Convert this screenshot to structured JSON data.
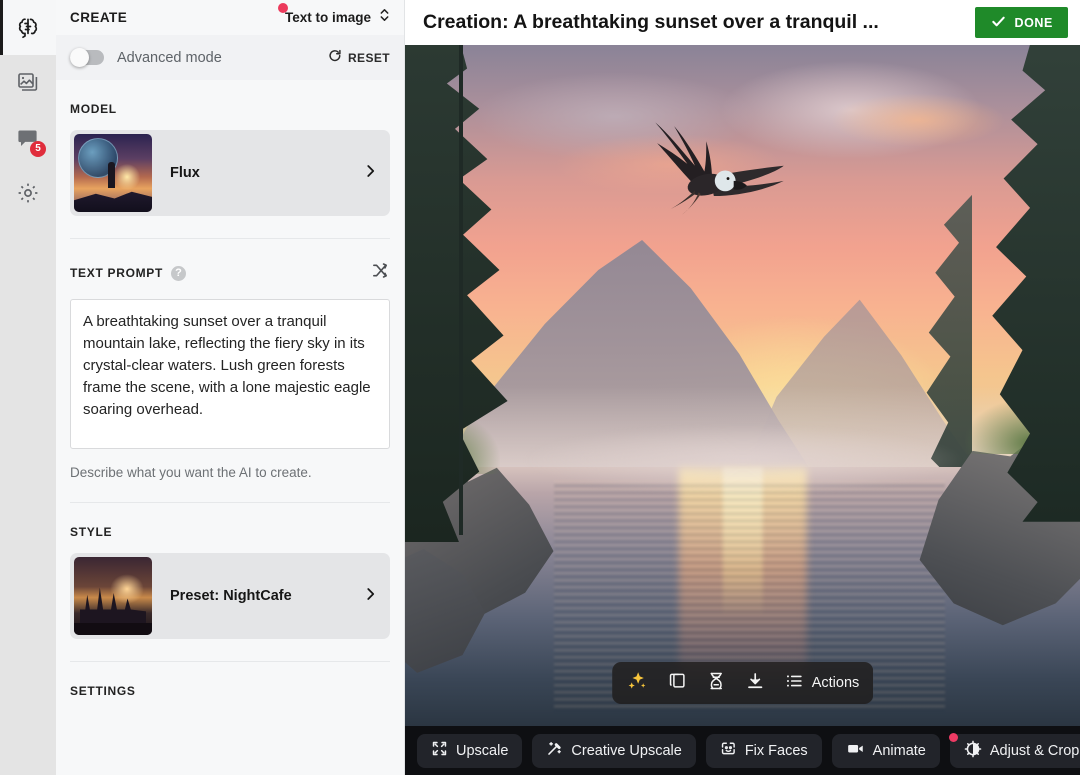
{
  "rail": {
    "items": [
      {
        "name": "create",
        "icon": "brain-icon",
        "active": true,
        "badge": null
      },
      {
        "name": "gallery",
        "icon": "images-icon",
        "active": false,
        "badge": null
      },
      {
        "name": "chat",
        "icon": "chat-bubble-icon",
        "active": false,
        "badge": "5"
      },
      {
        "name": "settings",
        "icon": "gear-icon",
        "active": false,
        "badge": null
      }
    ]
  },
  "panel": {
    "title": "CREATE",
    "mode": {
      "label": "Text to image",
      "icon": "chevron-updown-icon",
      "has_badge": true
    },
    "advanced": {
      "label": "Advanced mode",
      "enabled": false,
      "reset_label": "RESET",
      "reset_icon": "refresh-icon"
    },
    "model": {
      "section_label": "MODEL",
      "name": "Flux",
      "chevron": "chevron-right-icon",
      "thumbnail_alt": "figure-on-cliff-at-sunset-thumbnail"
    },
    "prompt": {
      "section_label": "TEXT PROMPT",
      "help_icon": "help-circle-icon",
      "help_glyph": "?",
      "shuffle_icon": "shuffle-icon",
      "value": "A breathtaking sunset over a tranquil mountain lake, reflecting the fiery sky in its crystal-clear waters. Lush green forests frame the scene, with a lone majestic eagle soaring overhead.",
      "placeholder": "Describe what you want the AI to create.",
      "hint": "Describe what you want the AI to create."
    },
    "style": {
      "section_label": "STYLE",
      "name": "Preset: NightCafe",
      "chevron": "chevron-right-icon",
      "thumbnail_alt": "castle-at-dusk-thumbnail"
    },
    "settings": {
      "section_label": "SETTINGS"
    }
  },
  "main": {
    "title": "Creation: A breathtaking sunset over a tranquil ...",
    "done_button": {
      "label": "DONE",
      "icon": "check-icon",
      "color": "#1f8a29"
    }
  },
  "float_toolbar": {
    "items": [
      {
        "name": "enhance",
        "icon": "sparkles-icon",
        "label": ""
      },
      {
        "name": "duplicate",
        "icon": "copy-icon",
        "label": ""
      },
      {
        "name": "evolve",
        "icon": "dna-icon",
        "label": ""
      },
      {
        "name": "download",
        "icon": "download-icon",
        "label": ""
      },
      {
        "name": "actions",
        "icon": "list-icon",
        "label": "Actions"
      }
    ],
    "actions_label": "Actions"
  },
  "bottom_bar": {
    "buttons": [
      {
        "name": "upscale",
        "label": "Upscale",
        "icon": "expand-icon",
        "badge": false
      },
      {
        "name": "creative-upscale",
        "label": "Creative Upscale",
        "icon": "magic-wand-icon",
        "badge": false
      },
      {
        "name": "fix-faces",
        "label": "Fix Faces",
        "icon": "face-icon",
        "badge": false
      },
      {
        "name": "animate",
        "label": "Animate",
        "icon": "video-camera-icon",
        "badge": false
      },
      {
        "name": "adjust-crop",
        "label": "Adjust & Crop",
        "icon": "contrast-icon",
        "badge": true
      }
    ]
  },
  "colors": {
    "accent_green": "#1f8a29",
    "badge_red": "#e02d3c",
    "badge_pink": "#ee3b64",
    "rail_bg": "#e4e4e4",
    "panel_bg": "#f7f8f9",
    "card_bg": "#e4e5e7",
    "bottom_bar_bg": "#0e0f12"
  }
}
